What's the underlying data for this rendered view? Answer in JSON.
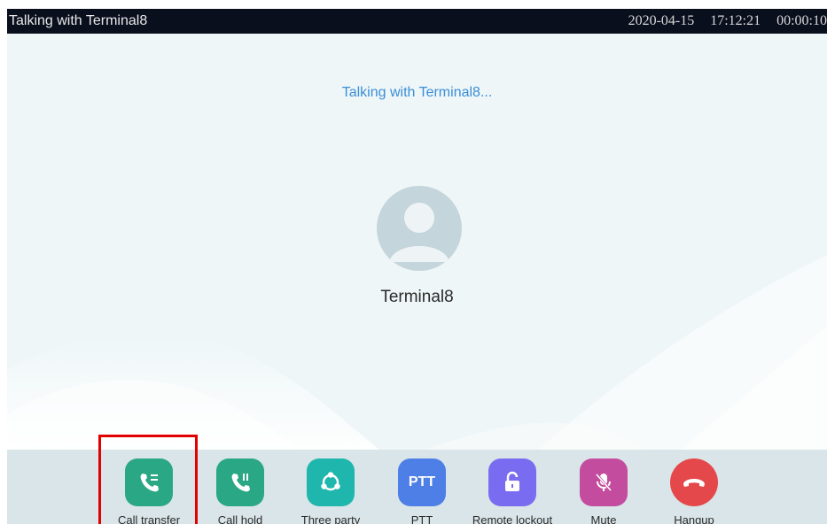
{
  "status_bar": {
    "title": "Talking with Terminal8",
    "date": "2020-04-15",
    "time": "17:12:21",
    "duration": "00:00:10"
  },
  "call": {
    "status_text": "Talking with Terminal8...",
    "contact_name": "Terminal8",
    "avatar_icon": "user-avatar-icon"
  },
  "actions": [
    {
      "label": "Call transfer",
      "icon": "call-transfer-icon",
      "color": "#2aa784"
    },
    {
      "label": "Call hold",
      "icon": "call-hold-icon",
      "color": "#2aa784"
    },
    {
      "label": "Three party",
      "icon": "three-party-icon",
      "color": "#1fb6ad"
    },
    {
      "label": "PTT",
      "icon": "ptt-icon",
      "icon_text": "PTT",
      "color": "#4e7fe6"
    },
    {
      "label": "Remote lockout",
      "icon": "unlock-icon",
      "color": "#7a6cf0"
    },
    {
      "label": "Mute",
      "icon": "microphone-muted-icon",
      "color": "#c44c9e"
    },
    {
      "label": "Hangup",
      "icon": "hangup-icon",
      "color": "#e5484a"
    }
  ],
  "highlight": {
    "target": "Call transfer",
    "color": "#e30000"
  }
}
